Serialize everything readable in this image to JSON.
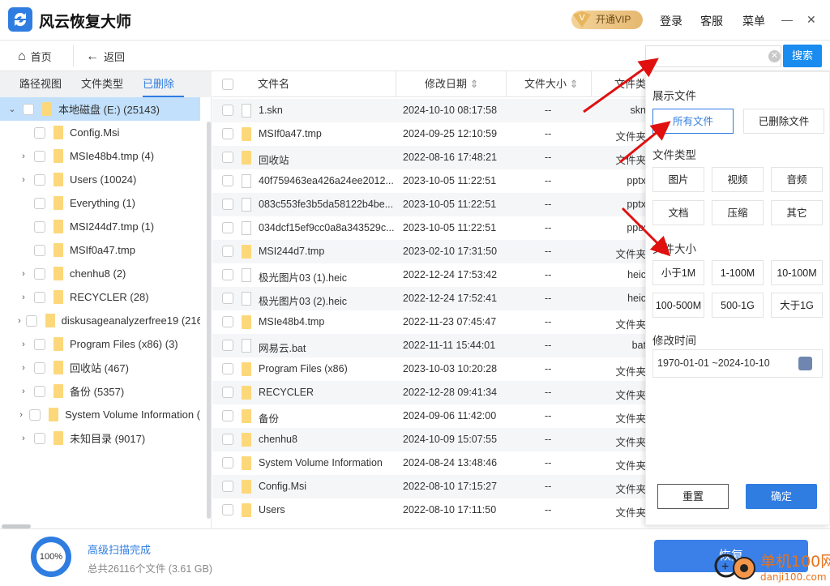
{
  "app": {
    "title": "风云恢复大师",
    "vip_label": "开通VIP",
    "login": "登录",
    "service": "客服",
    "menu": "菜单",
    "minimize": "—",
    "close": "✕"
  },
  "toolbar": {
    "home": "首页",
    "back": "返回"
  },
  "search": {
    "value": "",
    "placeholder": "",
    "button": "搜索"
  },
  "left_tabs": [
    {
      "label": "路径视图"
    },
    {
      "label": "文件类型"
    },
    {
      "label": "已删除",
      "active": true
    }
  ],
  "tree": [
    {
      "label": "本地磁盘 (E:) (25143)",
      "expanded": true,
      "selected": true,
      "level": 0
    },
    {
      "label": "Config.Msi",
      "level": 1,
      "children": false
    },
    {
      "label": "MSIe48b4.tmp (4)",
      "level": 1,
      "children": true
    },
    {
      "label": "Users (10024)",
      "level": 1,
      "children": true
    },
    {
      "label": "Everything (1)",
      "level": 1,
      "children": false
    },
    {
      "label": "MSI244d7.tmp (1)",
      "level": 1,
      "children": false
    },
    {
      "label": "MSIf0a47.tmp",
      "level": 1,
      "children": false
    },
    {
      "label": "chenhu8 (2)",
      "level": 1,
      "children": true
    },
    {
      "label": "RECYCLER (28)",
      "level": 1,
      "children": true
    },
    {
      "label": "diskusageanalyzerfree19 (216",
      "level": 1,
      "children": true
    },
    {
      "label": "Program Files (x86) (3)",
      "level": 1,
      "children": true
    },
    {
      "label": "回收站 (467)",
      "level": 1,
      "children": true
    },
    {
      "label": "备份 (5357)",
      "level": 1,
      "children": true
    },
    {
      "label": "System Volume Information (",
      "level": 1,
      "children": true
    },
    {
      "label": "未知目录 (9017)",
      "level": 1,
      "children": true
    }
  ],
  "table": {
    "columns": [
      "文件名",
      "修改日期",
      "文件大小",
      "文件类型"
    ],
    "rows": [
      {
        "name": "1.skn",
        "date": "2024-10-10 08:17:58",
        "size": "--",
        "type": "skn",
        "folder": false
      },
      {
        "name": "MSIf0a47.tmp",
        "date": "2024-09-25 12:10:59",
        "size": "--",
        "type": "文件夹",
        "folder": true
      },
      {
        "name": "回收站",
        "date": "2022-08-16 17:48:21",
        "size": "--",
        "type": "文件夹",
        "folder": true
      },
      {
        "name": "40f759463ea426a24ee2012...",
        "date": "2023-10-05 11:22:51",
        "size": "--",
        "type": "pptx",
        "folder": false
      },
      {
        "name": "083c553fe3b5da58122b4be...",
        "date": "2023-10-05 11:22:51",
        "size": "--",
        "type": "pptx",
        "folder": false
      },
      {
        "name": "034dcf15ef9cc0a8a343529c...",
        "date": "2023-10-05 11:22:51",
        "size": "--",
        "type": "pptx",
        "folder": false
      },
      {
        "name": "MSI244d7.tmp",
        "date": "2023-02-10 17:31:50",
        "size": "--",
        "type": "文件夹",
        "folder": true
      },
      {
        "name": "极光图片03 (1).heic",
        "date": "2022-12-24 17:53:42",
        "size": "--",
        "type": "heic",
        "folder": false
      },
      {
        "name": "极光图片03 (2).heic",
        "date": "2022-12-24 17:52:41",
        "size": "--",
        "type": "heic",
        "folder": false
      },
      {
        "name": "MSIe48b4.tmp",
        "date": "2022-11-23 07:45:47",
        "size": "--",
        "type": "文件夹",
        "folder": true
      },
      {
        "name": "网易云.bat",
        "date": "2022-11-11 15:44:01",
        "size": "--",
        "type": "bat",
        "folder": false
      },
      {
        "name": "Program Files (x86)",
        "date": "2023-10-03 10:20:28",
        "size": "--",
        "type": "文件夹",
        "folder": true
      },
      {
        "name": "RECYCLER",
        "date": "2022-12-28 09:41:34",
        "size": "--",
        "type": "文件夹",
        "folder": true
      },
      {
        "name": "备份",
        "date": "2024-09-06 11:42:00",
        "size": "--",
        "type": "文件夹",
        "folder": true
      },
      {
        "name": "chenhu8",
        "date": "2024-10-09 15:07:55",
        "size": "--",
        "type": "文件夹",
        "folder": true
      },
      {
        "name": "System Volume Information",
        "date": "2024-08-24 13:48:46",
        "size": "--",
        "type": "文件夹",
        "folder": true
      },
      {
        "name": "Config.Msi",
        "date": "2022-08-10 17:15:27",
        "size": "--",
        "type": "文件夹",
        "folder": true
      },
      {
        "name": "Users",
        "date": "2022-08-10 17:11:50",
        "size": "--",
        "type": "文件夹",
        "folder": true
      }
    ]
  },
  "filter": {
    "show_title": "展示文件",
    "show_options": [
      {
        "label": "所有文件",
        "selected": true
      },
      {
        "label": "已删除文件"
      }
    ],
    "type_title": "文件类型",
    "types": [
      "图片",
      "视频",
      "音频",
      "文档",
      "压缩",
      "其它"
    ],
    "size_title": "文件大小",
    "sizes": [
      "小于1M",
      "1-100M",
      "10-100M",
      "100-500M",
      "500-1G",
      "大于1G"
    ],
    "time_title": "修改时间",
    "date_range": "1970-01-01 ~2024-10-10",
    "reset": "重置",
    "confirm": "确定"
  },
  "status": {
    "progress_label": "100%",
    "progress": 100,
    "scan_done": "高级扫描完成",
    "total": "总共26116个文件 (3.61 GB)",
    "restore": "恢复"
  },
  "watermark": {
    "text": "单机100网",
    "url": "danji100.com"
  },
  "colors": {
    "accent": "#2f7de1",
    "selected_row": "#c2e0fb",
    "folder": "#fcd87a",
    "annotation_arrow": "#e01010"
  }
}
